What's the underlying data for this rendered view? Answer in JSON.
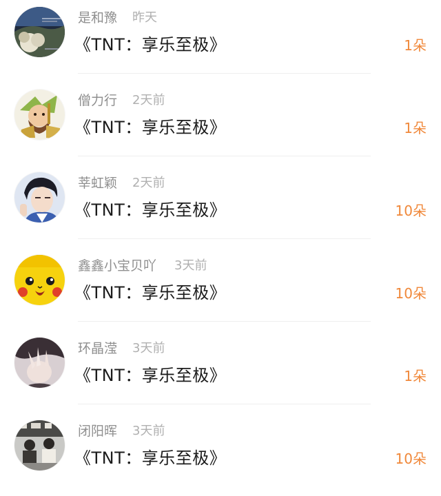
{
  "gifts": [
    {
      "user": "是和豫",
      "time": "昨天",
      "title": "《TNT：享乐至极》",
      "count": "1朵",
      "avatar": "avatar-landscape-photo"
    },
    {
      "user": "僧力行",
      "time": "2天前",
      "title": "《TNT：享乐至极》",
      "count": "1朵",
      "avatar": "avatar-cartoon-warrior"
    },
    {
      "user": "莘虹颖",
      "time": "2天前",
      "title": "《TNT：享乐至极》",
      "count": "10朵",
      "avatar": "avatar-boy-portrait"
    },
    {
      "user": "鑫鑫小宝贝吖",
      "time": "3天前",
      "title": "《TNT：享乐至极》",
      "count": "10朵",
      "avatar": "avatar-pikachu"
    },
    {
      "user": "环晶滢",
      "time": "3天前",
      "title": "《TNT：享乐至极》",
      "count": "1朵",
      "avatar": "avatar-hand-portrait"
    },
    {
      "user": "闭阳晖",
      "time": "3天前",
      "title": "《TNT：享乐至极》",
      "count": "10朵",
      "avatar": "avatar-group-photo"
    }
  ],
  "colors": {
    "accent": "#f0883a",
    "name_gray": "#8f8f8f",
    "time_gray": "#b0b0b0",
    "title_black": "#1c1c1c"
  }
}
